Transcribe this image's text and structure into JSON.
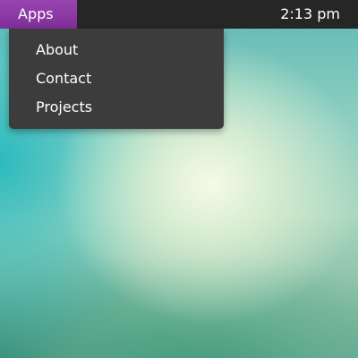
{
  "topbar": {
    "apps_label": "Apps",
    "clock": "2:13 pm",
    "accent_color": "#8e3aa8",
    "bar_color": "#262626"
  },
  "menu": {
    "items": [
      {
        "label": "About"
      },
      {
        "label": "Contact"
      },
      {
        "label": "Projects"
      }
    ],
    "background_color": "#3c3c3c"
  }
}
